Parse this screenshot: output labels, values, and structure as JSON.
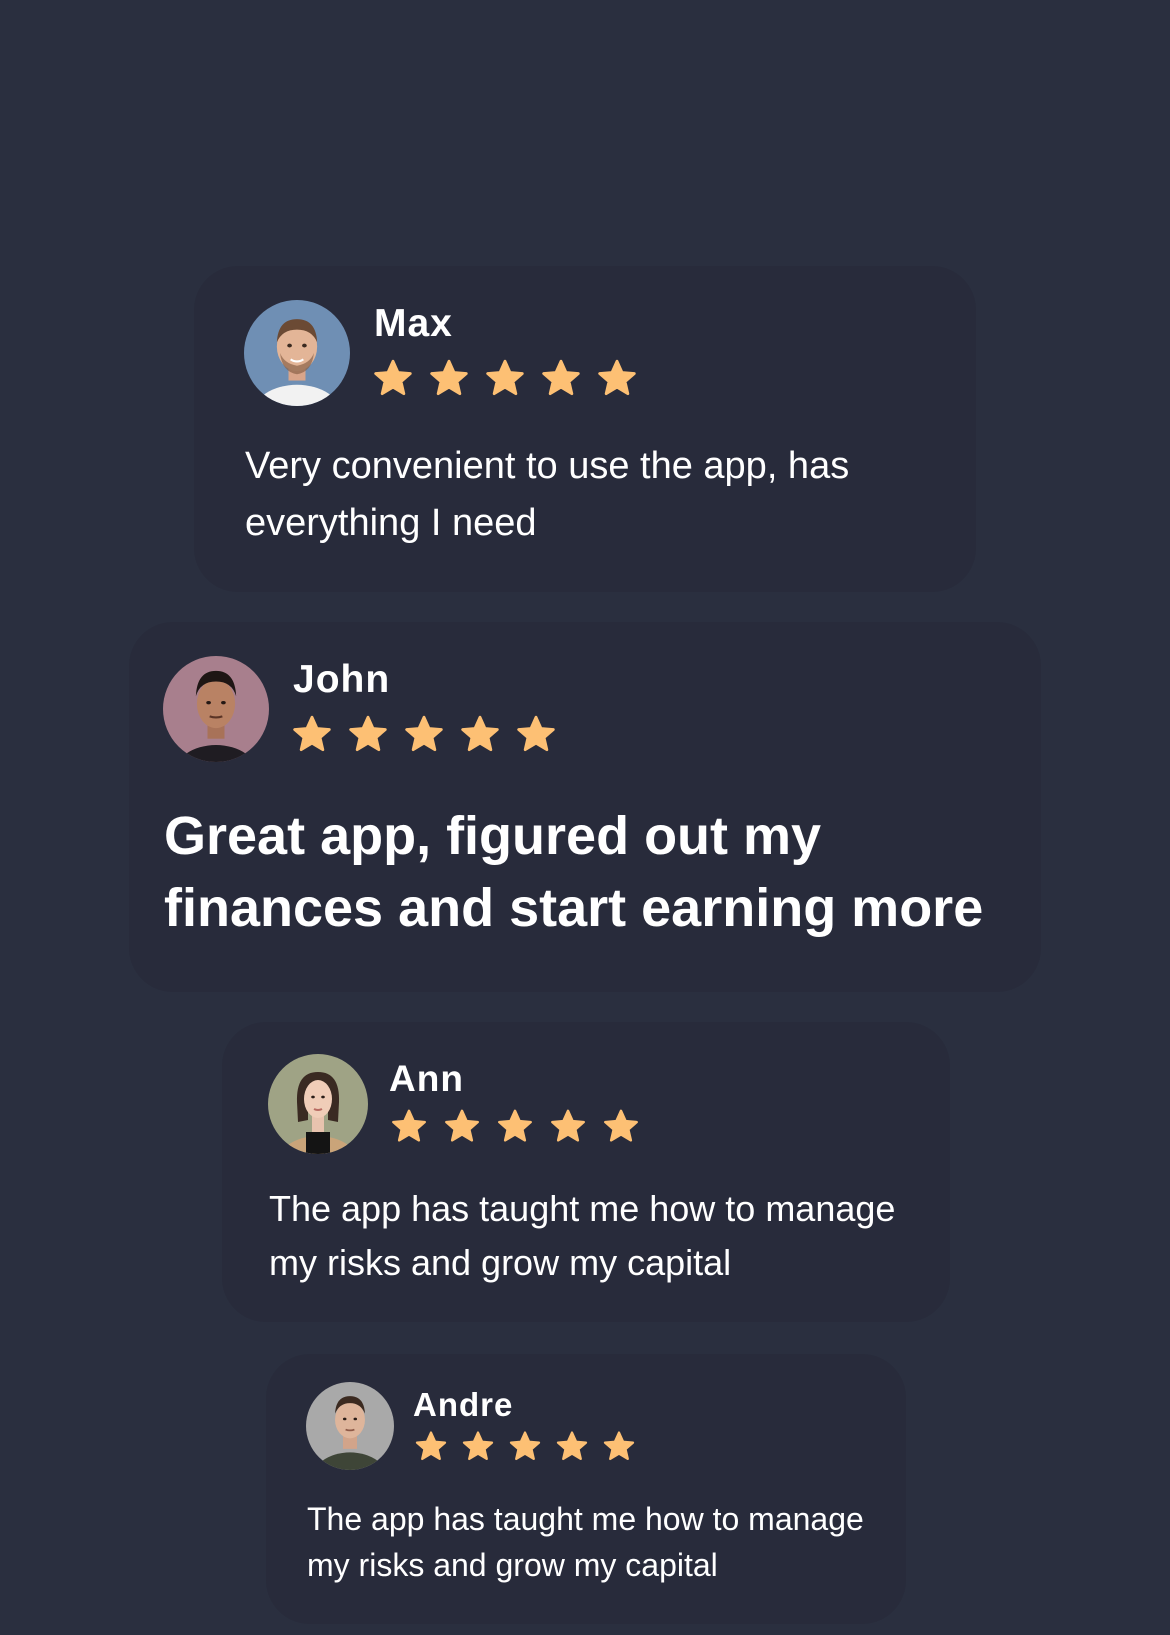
{
  "colors": {
    "background": "#2a2f3f",
    "card": "#282b3b",
    "star": "#fdc074",
    "text": "#ffffff"
  },
  "reviews": [
    {
      "name": "Max",
      "rating": 5,
      "rating_max": 5,
      "avatar_icon": "avatar-max",
      "text": "Very convenient to use the app, has everything I need"
    },
    {
      "name": "John",
      "rating": 5,
      "rating_max": 5,
      "avatar_icon": "avatar-john",
      "text": "Great app, figured out my finances and start earning more"
    },
    {
      "name": "Ann",
      "rating": 5,
      "rating_max": 5,
      "avatar_icon": "avatar-ann",
      "text": "The app has taught me how to manage  my risks and grow my capital"
    },
    {
      "name": "Andre",
      "rating": 5,
      "rating_max": 5,
      "avatar_icon": "avatar-andre",
      "text": "The app has taught me how to manage  my risks and grow my capital"
    }
  ]
}
